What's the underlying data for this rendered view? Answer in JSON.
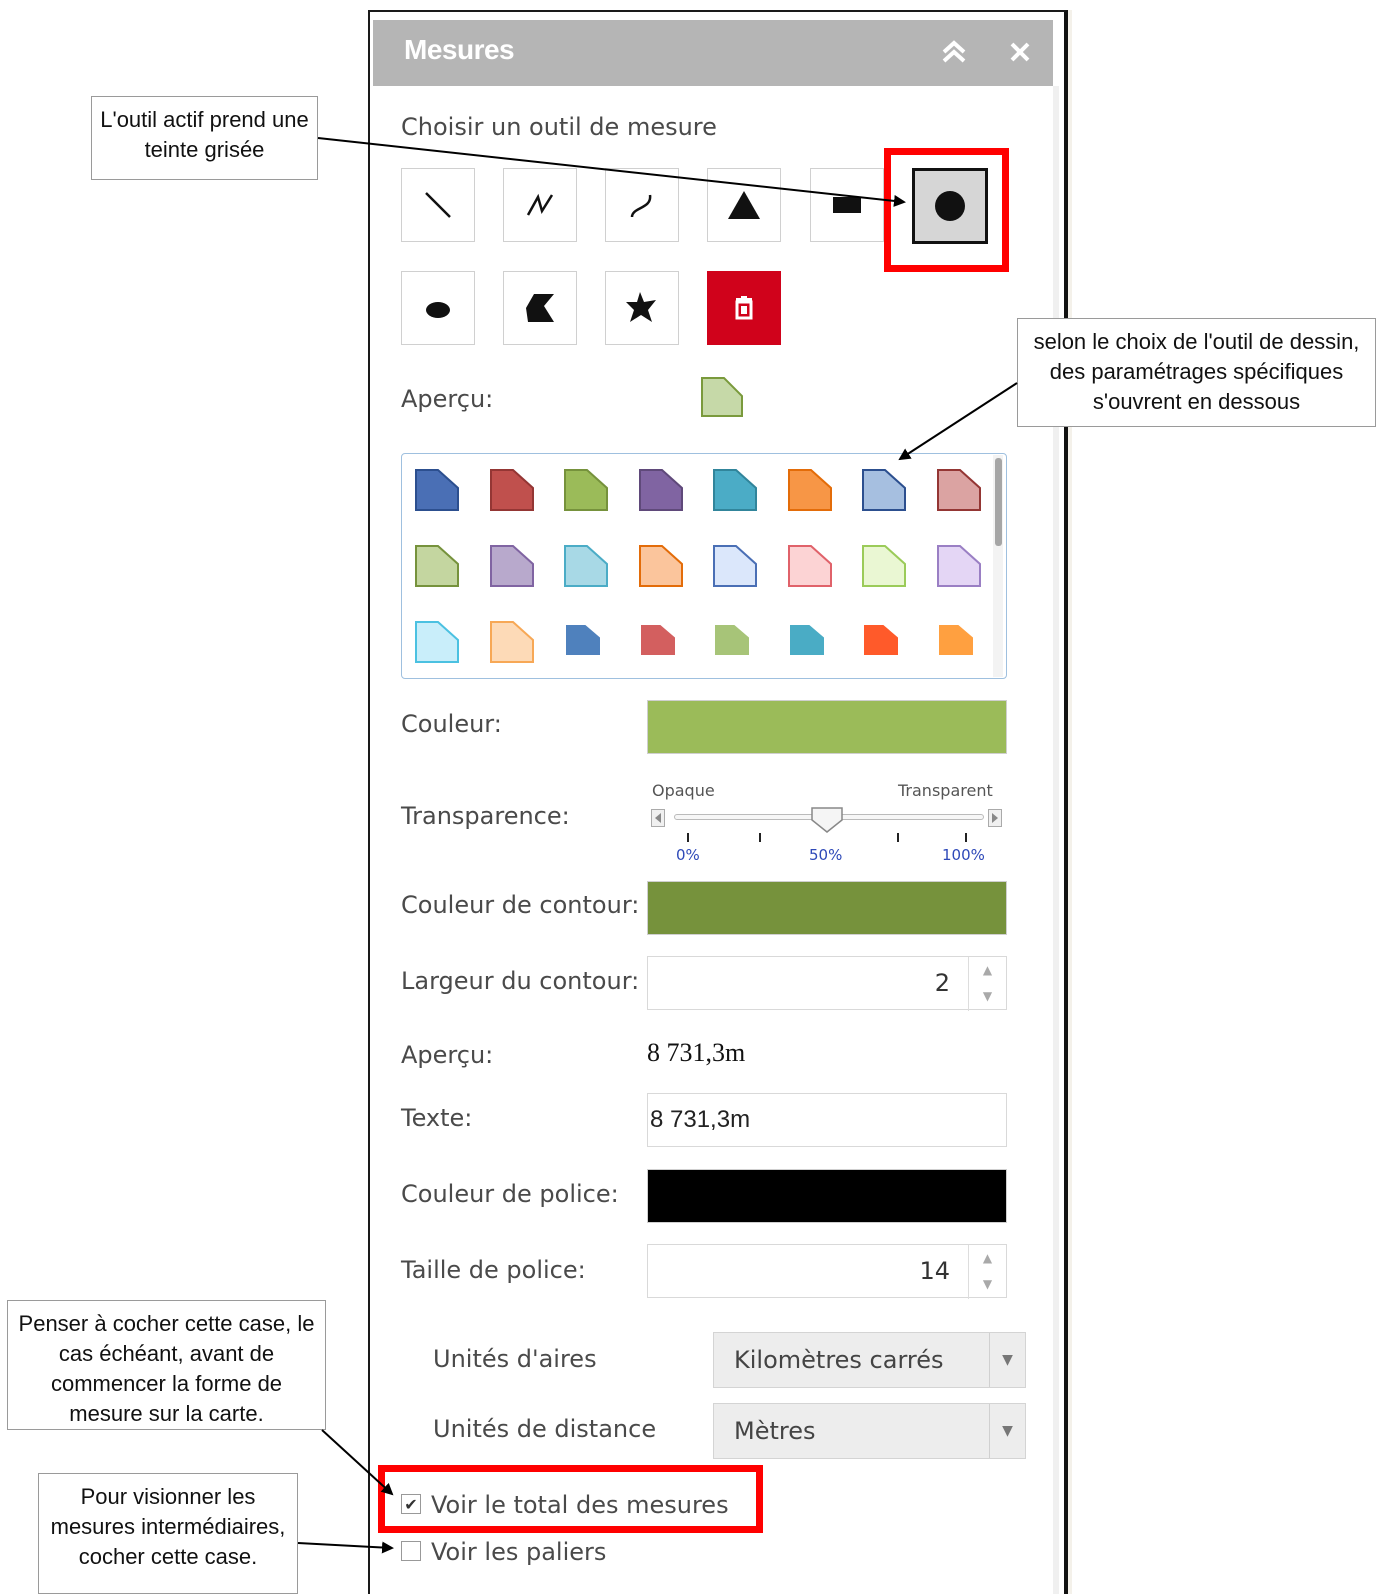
{
  "panel": {
    "title": "Mesures",
    "collapse_icon": "double-chevron-up-icon",
    "close_icon": "close-icon"
  },
  "tools": {
    "heading": "Choisir un outil de mesure",
    "row1": [
      "line-tool-icon",
      "polyline-tool-icon",
      "freehand-line-tool-icon",
      "triangle-tool-icon",
      "rectangle-tool-icon",
      "circle-tool-icon"
    ],
    "row2": [
      "ellipse-tool-icon",
      "polygon-tool-icon",
      "freehand-polygon-tool-icon",
      "trash-icon"
    ],
    "active": "circle-tool-icon",
    "delete_color": "#d0021b"
  },
  "preview": {
    "label": "Aperçu:",
    "fill": "#c6d9a8",
    "stroke": "#7a9a3c"
  },
  "palette": {
    "rows": [
      [
        {
          "fill": "#4a6fb5",
          "stroke": "#2c4f8f"
        },
        {
          "fill": "#c0504d",
          "stroke": "#943634"
        },
        {
          "fill": "#9bbb59",
          "stroke": "#76923c"
        },
        {
          "fill": "#8064a2",
          "stroke": "#5f497a"
        },
        {
          "fill": "#4bacc6",
          "stroke": "#31859b"
        },
        {
          "fill": "#f79646",
          "stroke": "#e36c09"
        },
        {
          "fill": "#a6bfe0",
          "stroke": "#2c4f8f"
        },
        {
          "fill": "#dba3a2",
          "stroke": "#943634"
        }
      ],
      [
        {
          "fill": "#c4d6a0",
          "stroke": "#76923c"
        },
        {
          "fill": "#b8a9cc",
          "stroke": "#8064a2"
        },
        {
          "fill": "#a8d9e6",
          "stroke": "#4bacc6"
        },
        {
          "fill": "#fbc59c",
          "stroke": "#e36c09"
        },
        {
          "fill": "#dbe7fb",
          "stroke": "#4a6fb5"
        },
        {
          "fill": "#fcd3d4",
          "stroke": "#e0626a"
        },
        {
          "fill": "#eaf7d3",
          "stroke": "#9bcb59"
        },
        {
          "fill": "#e4d6f5",
          "stroke": "#9a7fc4"
        }
      ],
      [
        {
          "fill": "#c9eefa",
          "stroke": "#4bc1e1"
        },
        {
          "fill": "#fddab7",
          "stroke": "#f7a856"
        },
        {
          "fill": "#4f81bd",
          "stroke": "#4f81bd"
        },
        {
          "fill": "#d35f5f",
          "stroke": "#d35f5f"
        },
        {
          "fill": "#a7c478",
          "stroke": "#a7c478"
        },
        {
          "fill": "#4aacc5",
          "stroke": "#4aacc5"
        },
        {
          "fill": "#ff5a2a",
          "stroke": "#ff5a2a"
        },
        {
          "fill": "#ffa040",
          "stroke": "#ffa040"
        }
      ]
    ]
  },
  "color": {
    "label": "Couleur:",
    "value": "#9bbb59"
  },
  "transparency": {
    "label": "Transparence:",
    "left_label": "Opaque",
    "right_label": "Transparent",
    "ticks": [
      "0%",
      "50%",
      "100%"
    ],
    "value_percent": 50
  },
  "outline_color": {
    "label": "Couleur de contour:",
    "value": "#76923c"
  },
  "outline_width": {
    "label": "Largeur du contour:",
    "value": "2"
  },
  "text_preview": {
    "label": "Aperçu:",
    "value": "8 731,3m"
  },
  "text": {
    "label": "Texte:",
    "value": "8 731,3m"
  },
  "font_color": {
    "label": "Couleur de police:",
    "value": "#000000"
  },
  "font_size": {
    "label": "Taille de police:",
    "value": "14"
  },
  "area_units": {
    "label": "Unités d'aires",
    "value": "Kilomètres carrés"
  },
  "distance_units": {
    "label": "Unités de distance",
    "value": "Mètres"
  },
  "show_total": {
    "label": "Voir le total des mesures",
    "checked": true
  },
  "show_steps": {
    "label": "Voir les paliers",
    "checked": false
  },
  "callouts": {
    "active_tool_lines": [
      "L'outil actif prend une",
      "teinte grisée"
    ],
    "settings_lines": [
      "selon le choix de l'outil de dessin,",
      "des paramétrages spécifiques",
      "s'ouvrent en dessous"
    ],
    "check_total_lines": [
      "Penser à cocher cette case, le",
      "cas échéant, avant de",
      "commencer la forme de",
      "mesure sur la carte."
    ],
    "check_steps_lines": [
      "Pour visionner les",
      "mesures intermédiaires,",
      "cocher cette case."
    ]
  },
  "highlight_color": "#ff0000"
}
